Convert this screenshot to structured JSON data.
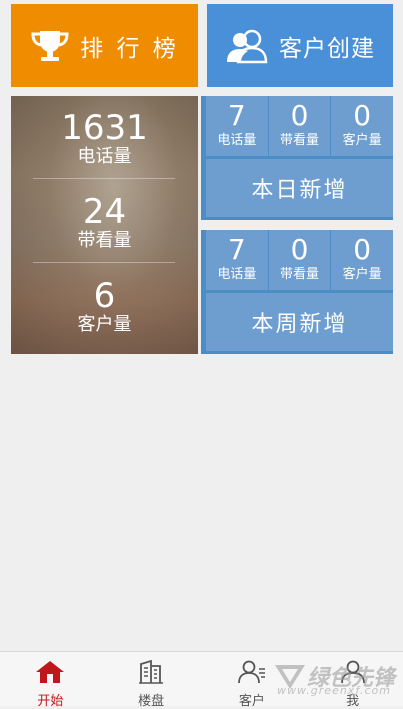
{
  "tiles": {
    "ranking": {
      "label": "排 行 榜",
      "icon": "trophy-icon",
      "color": "#ef8c00"
    },
    "create_client": {
      "label": "客户创建",
      "icon": "users-icon",
      "color": "#4a90d9"
    }
  },
  "totals": [
    {
      "value": "1631",
      "label": "电话量"
    },
    {
      "value": "24",
      "label": "带看量"
    },
    {
      "value": "6",
      "label": "客户量"
    }
  ],
  "today": {
    "title": "本日新增",
    "stats": [
      {
        "value": "7",
        "label": "电话量"
      },
      {
        "value": "0",
        "label": "带看量"
      },
      {
        "value": "0",
        "label": "客户量"
      }
    ]
  },
  "week": {
    "title": "本周新增",
    "stats": [
      {
        "value": "7",
        "label": "电话量"
      },
      {
        "value": "0",
        "label": "带看量"
      },
      {
        "value": "0",
        "label": "客户量"
      }
    ]
  },
  "tabbar": {
    "active": "开始",
    "items": [
      {
        "label": "开始",
        "icon": "home-icon"
      },
      {
        "label": "楼盘",
        "icon": "building-icon"
      },
      {
        "label": "客户",
        "icon": "client-icon"
      },
      {
        "label": "我",
        "icon": "person-icon"
      }
    ]
  },
  "watermark": {
    "text": "绿色先锋",
    "url": "www.greenxf.com"
  }
}
